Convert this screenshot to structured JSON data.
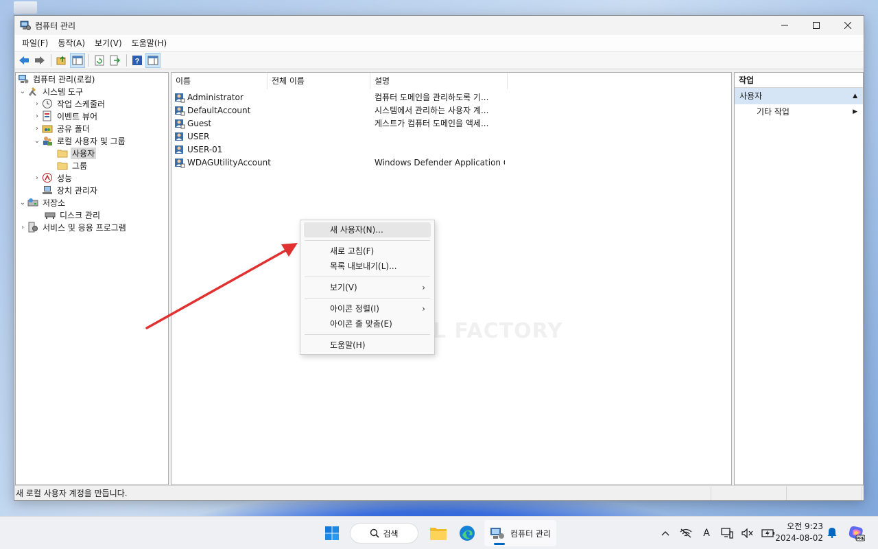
{
  "window": {
    "title": "컴퓨터 관리"
  },
  "menu": [
    "파일(F)",
    "동작(A)",
    "보기(V)",
    "도움말(H)"
  ],
  "tree": {
    "root": "컴퓨터 관리(로컬)",
    "system_tools": "시스템 도구",
    "task_scheduler": "작업 스케줄러",
    "event_viewer": "이벤트 뷰어",
    "shared_folders": "공유 폴더",
    "local_users_groups": "로컬 사용자 및 그룹",
    "users": "사용자",
    "groups": "그룹",
    "performance": "성능",
    "device_manager": "장치 관리자",
    "storage": "저장소",
    "disk_management": "디스크 관리",
    "services_apps": "서비스 및 응용 프로그램"
  },
  "list": {
    "columns": [
      "이름",
      "전체 이름",
      "설명"
    ],
    "rows": [
      {
        "name": "Administrator",
        "full_name": "",
        "description": "컴퓨터 도메인을 관리하도록 기..."
      },
      {
        "name": "DefaultAccount",
        "full_name": "",
        "description": "시스템에서 관리하는 사용자 계..."
      },
      {
        "name": "Guest",
        "full_name": "",
        "description": "게스트가 컴퓨터 도메인을 액세..."
      },
      {
        "name": "USER",
        "full_name": "",
        "description": ""
      },
      {
        "name": "USER-01",
        "full_name": "",
        "description": ""
      },
      {
        "name": "WDAGUtilityAccount",
        "full_name": "",
        "description": "Windows Defender Application G..."
      }
    ]
  },
  "watermark": "MANUAL FACTORY",
  "actions": {
    "header": "작업",
    "section": "사용자",
    "more": "기타 작업"
  },
  "context_menu": {
    "new_user": "새 사용자(N)...",
    "refresh": "새로 고침(F)",
    "export": "목록 내보내기(L)...",
    "view": "보기(V)",
    "arrange": "아이콘 정렬(I)",
    "line_up": "아이콘 줄 맞춤(E)",
    "help": "도움말(H)"
  },
  "status": {
    "text": "새 로컬 사용자 계정을 만듭니다."
  },
  "taskbar": {
    "search": "검색",
    "app_label": "컴퓨터 관리",
    "time": "오전 9:23",
    "date": "2024-08-02"
  },
  "colors": {
    "selection": "#cce4f7",
    "action_section": "#d5e5f5",
    "arrow": "#e03030",
    "accent": "#0067c0"
  }
}
